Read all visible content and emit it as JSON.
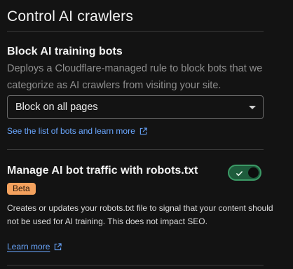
{
  "page": {
    "title": "Control AI crawlers"
  },
  "block_section": {
    "heading": "Block AI training bots",
    "description": "Deploys a Cloudflare-managed rule to block bots that we categorize as AI crawlers from visiting your site.",
    "select_value": "Block on all pages",
    "link_text": "See the list of bots and learn more"
  },
  "robots_section": {
    "heading": "Manage AI bot traffic with robots.txt",
    "badge": "Beta",
    "description": "Creates or updates your robots.txt file to signal that your content should not be used for AI training. This does not impact SEO.",
    "link_text": "Learn more",
    "toggle_on": true
  },
  "colors": {
    "background": "#131313",
    "link": "#6aa7ff",
    "toggle_track": "#1e5c3c",
    "toggle_border": "#3c9a66",
    "badge": "#f4a15d"
  },
  "icons": {
    "external_link": "external-link-icon",
    "dropdown": "chevron-down-icon",
    "toggle_check": "check-icon"
  }
}
